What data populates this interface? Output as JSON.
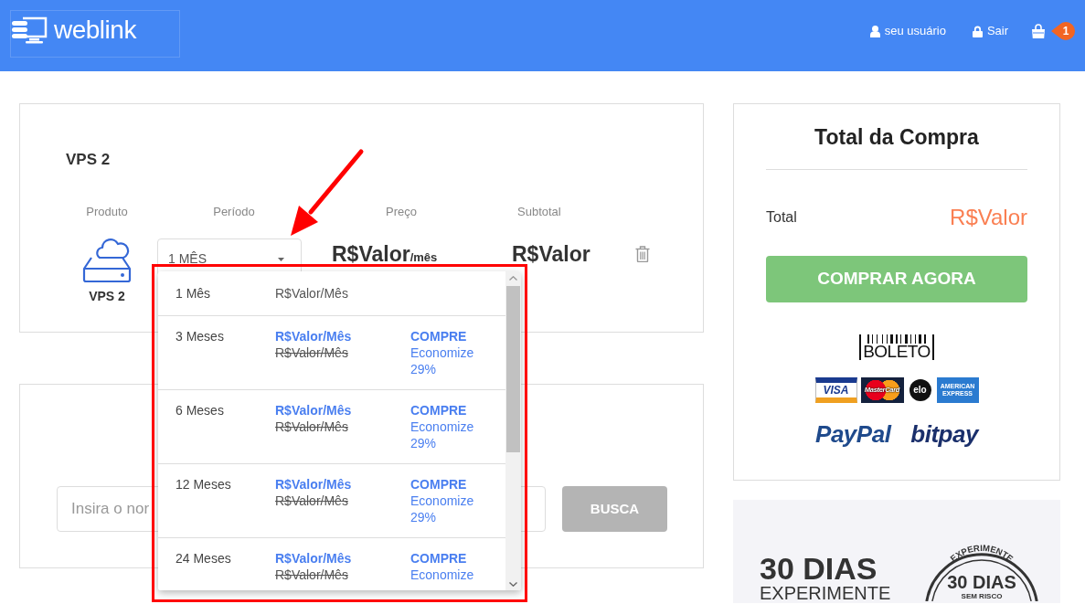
{
  "header": {
    "logo": "weblink",
    "links": [
      {
        "kind": "user",
        "label": "seu usuário"
      },
      {
        "kind": "logout",
        "label": "Sair"
      }
    ],
    "cart_count": "1"
  },
  "cart": {
    "title": "VPS 2",
    "columns": [
      "Produto",
      "Período",
      "Preço",
      "Subtotal"
    ],
    "item": {
      "name": "VPS 2",
      "price": "R$Valor",
      "price_unit": "/mês",
      "subtotal": "R$Valor"
    },
    "period": {
      "value": "1 MÊS",
      "expanded": true,
      "options": [
        {
          "kind": "plain",
          "period": "1 Mês",
          "price": "R$Valor/Mês"
        },
        {
          "kind": "discount",
          "period": "3 Meses",
          "price": "R$Valor/Mês",
          "old_price": "R$Valor/Mês",
          "action": "COMPRE",
          "saving": "Economize 29%"
        },
        {
          "kind": "discount",
          "period": "6 Meses",
          "price": "R$Valor/Mês",
          "old_price": "R$Valor/Mês",
          "action": "COMPRE",
          "saving": "Economize 29%"
        },
        {
          "kind": "discount",
          "period": "12 Meses",
          "price": "R$Valor/Mês",
          "old_price": "R$Valor/Mês",
          "action": "COMPRE",
          "saving": "Economize 29%"
        },
        {
          "kind": "discount",
          "period": "24 Meses",
          "price": "R$Valor/Mês",
          "old_price": "R$Valor/Mês",
          "action": "COMPRE",
          "saving": "Economize"
        }
      ]
    }
  },
  "search": {
    "placeholder": "Insira o nor",
    "button": "BUSCA"
  },
  "summary": {
    "title": "Total da Compra",
    "total_label": "Total",
    "total_value": "R$Valor",
    "button": "COMPRAR AGORA",
    "payment_rows": [
      {
        "logos": [
          {
            "kind": "boleto",
            "label": "BOLETO"
          }
        ]
      },
      {
        "logos": [
          {
            "kind": "visa",
            "label": "VISA"
          },
          {
            "kind": "mastercard",
            "label": "MasterCard"
          },
          {
            "kind": "elo",
            "label": "elo"
          },
          {
            "kind": "amex",
            "label": "AMERICAN EXPRESS"
          }
        ]
      },
      {
        "logos": [
          {
            "kind": "paypal",
            "label": "PayPal"
          },
          {
            "kind": "bitpay",
            "label": "bitpay"
          }
        ]
      }
    ]
  },
  "promo": {
    "title": "30 DIAS",
    "subtitle": "EXPERIMENTE",
    "stamp": {
      "top": "EXPERIMENTE",
      "middle": "30 DIAS",
      "bottom": "SEM RISCO"
    }
  }
}
